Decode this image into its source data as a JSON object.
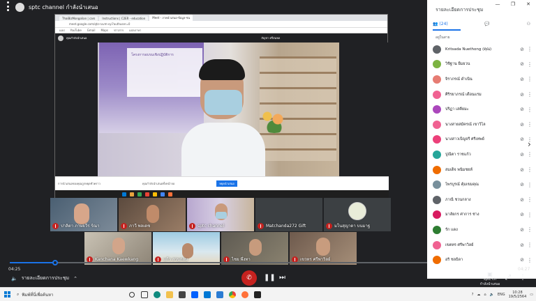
{
  "channel": {
    "name": "sptc channel กำลังนำเสนอ"
  },
  "shared_screen": {
    "tabs": [
      "ThaiBizMongolian | cars",
      "Instructions | C2ER - education",
      "Meet - ภาคนำเสนอ-ข้อมูล-ชน"
    ],
    "url": "meet.google.com/qtz-ruvm-vyi?authuser=0",
    "bookmarks": [
      "แอป",
      "YouTube",
      "Gmail",
      "Maps",
      "ข่าวสาร",
      "แปลภาษา"
    ],
    "meet_header": "คุณกำลังนำเสนอ",
    "presenter_caption": "สัญชา ศรีสมพล",
    "banner_text": "โครงการอบรมเชิงปฏิบัติการ",
    "bottom_text": "การนำเสนอของคุณถูกหยุดชั่วคราว",
    "bottom_text2": "คุณกำลังนำเสนอทั้งหน้าจอ",
    "stop_button": "หยุดนำเสนอ"
  },
  "tiles": [
    {
      "label": "ปาลิตา ภาษยวีร ร์ณา"
    },
    {
      "label": "ภาวี พลเดช"
    },
    {
      "label": "sptc channel"
    },
    {
      "label": "Matchanda272 Gift"
    },
    {
      "label": "มโนสุญาดา บนมาฐ"
    },
    {
      "label": "Kanchana Kaewkang"
    },
    {
      "label": "แก้ว สวนกลม"
    },
    {
      "label": "ไชย พึ่งทา"
    },
    {
      "label": "เขวทร ศรีพาวิลย์"
    }
  ],
  "panel": {
    "title": "รายละเอียดการประชุม",
    "participants_count": "(24)",
    "section": "อยู่ในสาย",
    "participants": [
      {
        "name": "Kritsada Nuethong (คุณ)",
        "color": "#5f6368"
      },
      {
        "name": "วิชิฐาน ยิ้มยวน",
        "color": "#7cb342"
      },
      {
        "name": "จิราภรณ์ ดำเนิน",
        "color": "#e67c73"
      },
      {
        "name": "ศิริรยาภรณ์ เดือนแรม",
        "color": "#f06292"
      },
      {
        "name": "ปริฏา เสคียมะ",
        "color": "#ab47bc"
      },
      {
        "name": "นางสายสมัครณ์ เขาวิไล",
        "color": "#f06292"
      },
      {
        "name": "นางสาวเบ็ญจรี ศรีเทพย์",
        "color": "#ec407a"
      },
      {
        "name": "ปูณีตา ราชแก้ว",
        "color": "#26a69a"
      },
      {
        "name": "สมเด็จ พนิมชยห์",
        "color": "#ef6c00"
      },
      {
        "name": "ไพรบูรณ์ คุ้มเขมคุณ",
        "color": "#78909c"
      },
      {
        "name": "ภาณี ชวนกลาง",
        "color": "#5f6368"
      },
      {
        "name": "มาลัยกร ศาการ ช่าง",
        "color": "#d81b60"
      },
      {
        "name": "รัก แดง",
        "color": "#2e7d32"
      },
      {
        "name": "เขตทร ศรีพาวิลย์",
        "color": "#f06292"
      },
      {
        "name": "อริ ชลธิดา",
        "color": "#ef6c00"
      }
    ]
  },
  "player": {
    "current_time": "04:25",
    "total_time": "04:27",
    "meeting_details_label": "รายละเอียดการประชุม",
    "presenter_label": "sptc ch",
    "presenter_sublabel": "กำลังนำเสนอ"
  },
  "taskbar": {
    "search_placeholder": "พิมพ์ที่นี่เพื่อค้นหา",
    "lang": "ENG",
    "time": "10:28",
    "date": "19/5/2564"
  },
  "colors": {
    "accent": "#1a73e8",
    "danger": "#c5221f",
    "bg_dark": "#202124"
  }
}
